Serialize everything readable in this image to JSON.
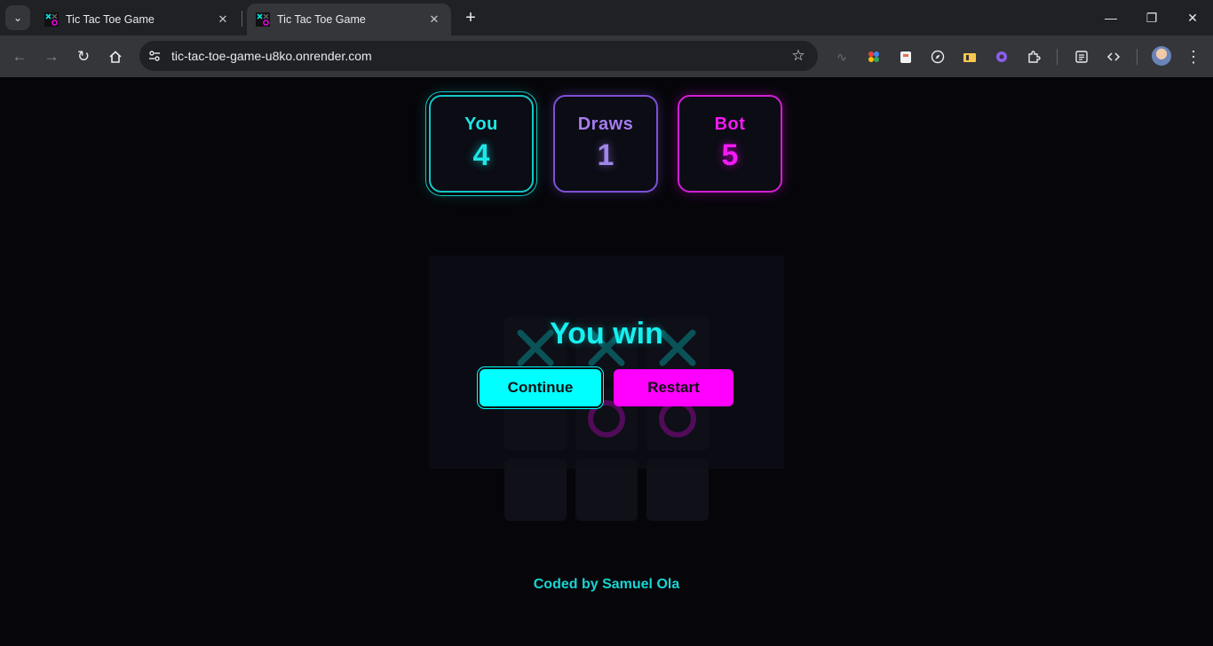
{
  "browser": {
    "tabs": [
      {
        "title": "Tic Tac Toe Game",
        "active": false
      },
      {
        "title": "Tic Tac Toe Game",
        "active": true
      }
    ],
    "url": "tic-tac-toe-game-u8ko.onrender.com"
  },
  "scoreboard": {
    "you": {
      "label": "You",
      "value": "4"
    },
    "draws": {
      "label": "Draws",
      "value": "1"
    },
    "bot": {
      "label": "Bot",
      "value": "5"
    }
  },
  "board": {
    "cells": [
      "X",
      "X",
      "X",
      "",
      "O",
      "O",
      "",
      "",
      ""
    ]
  },
  "result": {
    "message": "You win",
    "continue_label": "Continue",
    "restart_label": "Restart"
  },
  "footer": {
    "credit": "Coded by Samuel Ola"
  },
  "colors": {
    "you": "#00ffff",
    "draws": "#8a5cf0",
    "bot": "#ff00ff",
    "background": "#06060a"
  }
}
